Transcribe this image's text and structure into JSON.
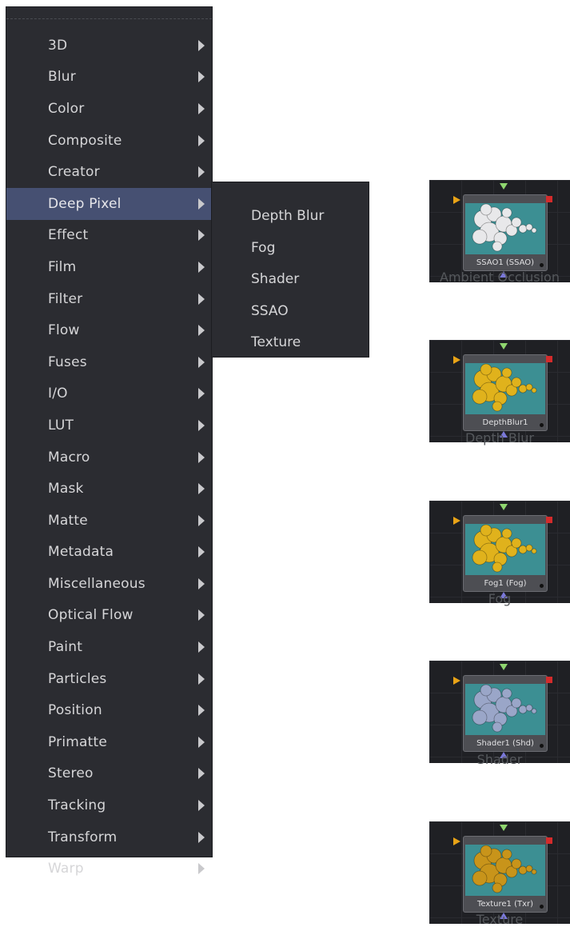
{
  "menu": {
    "items": [
      {
        "label": "3D"
      },
      {
        "label": "Blur"
      },
      {
        "label": "Color"
      },
      {
        "label": "Composite"
      },
      {
        "label": "Creator"
      },
      {
        "label": "Deep Pixel"
      },
      {
        "label": "Effect"
      },
      {
        "label": "Film"
      },
      {
        "label": "Filter"
      },
      {
        "label": "Flow"
      },
      {
        "label": "Fuses"
      },
      {
        "label": "I/O"
      },
      {
        "label": "LUT"
      },
      {
        "label": "Macro"
      },
      {
        "label": "Mask"
      },
      {
        "label": "Matte"
      },
      {
        "label": "Metadata"
      },
      {
        "label": "Miscellaneous"
      },
      {
        "label": "Optical Flow"
      },
      {
        "label": "Paint"
      },
      {
        "label": "Particles"
      },
      {
        "label": "Position"
      },
      {
        "label": "Primatte"
      },
      {
        "label": "Stereo"
      },
      {
        "label": "Tracking"
      },
      {
        "label": "Transform"
      },
      {
        "label": "Warp"
      }
    ],
    "active_index": 5
  },
  "submenu": {
    "items": [
      {
        "label": "Depth Blur"
      },
      {
        "label": "Fog"
      },
      {
        "label": "Shader"
      },
      {
        "label": "SSAO"
      },
      {
        "label": "Texture"
      }
    ]
  },
  "nodes": [
    {
      "node_label": "SSAO1  (SSAO)",
      "caption": "Ambient Occlusion",
      "ball_color": "#e8e8ea"
    },
    {
      "node_label": "DepthBlur1",
      "caption": "Depth Blur",
      "ball_color": "#e0b21c"
    },
    {
      "node_label": "Fog1  (Fog)",
      "caption": "Fog",
      "ball_color": "#e0b21c"
    },
    {
      "node_label": "Shader1  (Shd)",
      "caption": "Shader",
      "ball_color": "#9aa6c8"
    },
    {
      "node_label": "Texture1  (Txr)",
      "caption": "Texture",
      "ball_color": "#c8941a"
    }
  ],
  "colors": {
    "menu_bg": "#2b2c31",
    "menu_active": "#465072",
    "node_view": "#3c8f93"
  }
}
